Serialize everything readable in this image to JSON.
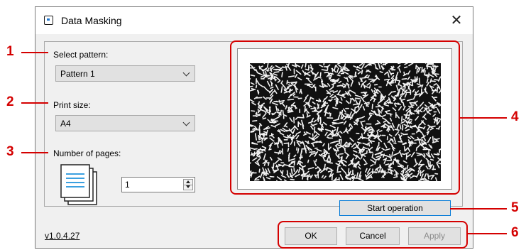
{
  "window": {
    "title": "Data Masking",
    "close_glyph": "✕"
  },
  "pattern": {
    "label": "Select pattern:",
    "value": "Pattern 1"
  },
  "print_size": {
    "label": "Print size:",
    "value": "A4"
  },
  "pages": {
    "label": "Number of pages:",
    "value": "1",
    "icon": "document-stack-icon"
  },
  "preview": {
    "icon": "data-masking-pattern-preview"
  },
  "buttons": {
    "start_operation": "Start operation",
    "ok": "OK",
    "cancel": "Cancel",
    "apply": "Apply"
  },
  "version": "v1.0.4.27",
  "callouts": [
    "1",
    "2",
    "3",
    "4",
    "5",
    "6"
  ],
  "colors": {
    "callout": "#d40000",
    "dialog_bg": "#f0f0f0",
    "focus_border": "#0078d7"
  }
}
